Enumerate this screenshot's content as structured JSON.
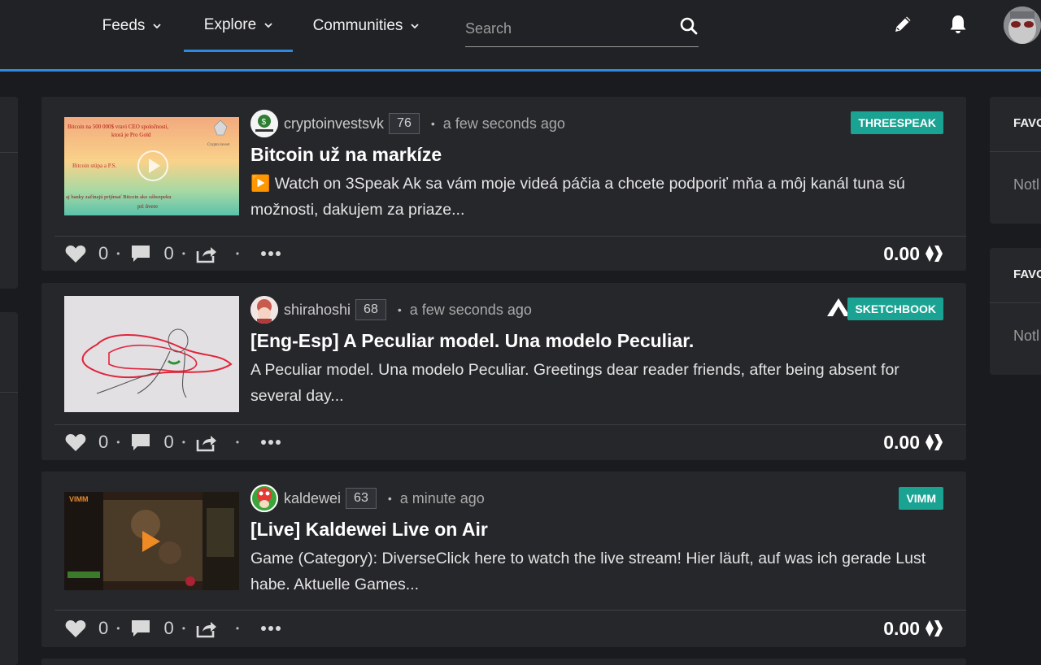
{
  "nav": {
    "feeds": "Feeds",
    "explore": "Explore",
    "communities": "Communities",
    "search_placeholder": "Search"
  },
  "sidebar_right": [
    {
      "title": "FAVO",
      "body": "Notl"
    },
    {
      "title": "FAVO",
      "body": "Notl"
    }
  ],
  "posts": [
    {
      "author": "cryptoinvestsvk",
      "reputation": "76",
      "time": "a few seconds ago",
      "tag": "THREESPEAK",
      "title": "Bitcoin už na markíze",
      "excerpt": "▶️ Watch on 3Speak Ak sa vám moje videá páčia a chcete podporiť mňa a môj kanál tuna sú možnosti, dakujem za priaze...",
      "likes": "0",
      "comments": "0",
      "payout": "0.00",
      "thumb_text": [
        "Bitcoin na 500 000$ vravi CEO spoločnosti,",
        "ktorá je Pro Gold",
        "Bitcoin stúpa a P.S.",
        "aj banky začínajú prijímať Bitcoin ako zábezpeku",
        "pri úvere",
        "Crypto invest"
      ]
    },
    {
      "author": "shirahoshi",
      "reputation": "68",
      "time": "a few seconds ago",
      "tag": "SKETCHBOOK",
      "title": "[Eng-Esp] A Peculiar model. Una modelo Peculiar.",
      "excerpt": "A Peculiar model. Una modelo Peculiar. Greetings dear reader friends, after being absent for several day...",
      "likes": "0",
      "comments": "0",
      "payout": "0.00"
    },
    {
      "author": "kaldewei",
      "reputation": "63",
      "time": "a minute ago",
      "tag": "VIMM",
      "title": "[Live] Kaldewei Live on Air",
      "excerpt": "Game (Category): DiverseClick here to watch the live stream! Hier läuft, auf was ich gerade Lust habe. Aktuelle Games...",
      "likes": "0",
      "comments": "0",
      "payout": "0.00",
      "thumb_text": [
        "VIMM"
      ]
    }
  ],
  "colors": {
    "accent": "#2d8ae0",
    "tag": "#1aa393",
    "background": "#1a1b1f",
    "card": "#26272b"
  }
}
